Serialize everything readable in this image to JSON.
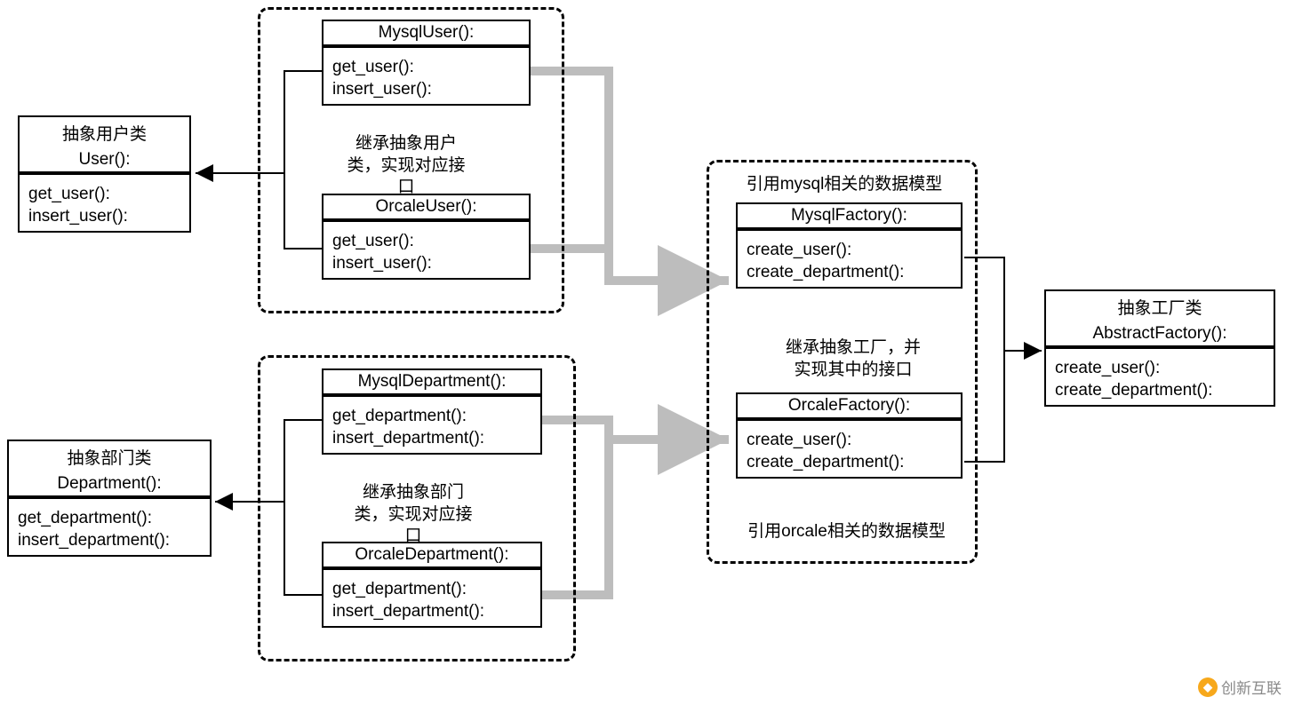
{
  "abstract_user": {
    "label": "抽象用户类",
    "name": "User():",
    "m1": "get_user():",
    "m2": "insert_user():"
  },
  "abstract_dept": {
    "label": "抽象部门类",
    "name": "Department():",
    "m1": "get_department():",
    "m2": "insert_department():"
  },
  "mysql_user": {
    "name": "MysqlUser():",
    "m1": "get_user():",
    "m2": "insert_user():"
  },
  "oracle_user": {
    "name": "OrcaleUser():",
    "m1": "get_user():",
    "m2": "insert_user():"
  },
  "mysql_dept": {
    "name": "MysqlDepartment():",
    "m1": "get_department():",
    "m2": "insert_department():"
  },
  "oracle_dept": {
    "name": "OrcaleDepartment():",
    "m1": "get_department():",
    "m2": "insert_department():"
  },
  "mysql_factory": {
    "name": "MysqlFactory():",
    "m1": "create_user():",
    "m2": "create_department():"
  },
  "oracle_factory": {
    "name": "OrcaleFactory():",
    "m1": "create_user():",
    "m2": "create_department():"
  },
  "abstract_factory": {
    "label": "抽象工厂类",
    "name": "AbstractFactory():",
    "m1": "create_user():",
    "m2": "create_department():"
  },
  "notes": {
    "user_group": "继承抽象用户\n类，实现对应接\n口",
    "dept_group": "继承抽象部门\n类，实现对应接\n口",
    "mysql_ref": "引用mysql相关的数据模型",
    "oracle_ref": "引用orcale相关的数据模型",
    "factory_inherit": "继承抽象工厂，并\n实现其中的接口"
  },
  "watermark": "创新互联"
}
